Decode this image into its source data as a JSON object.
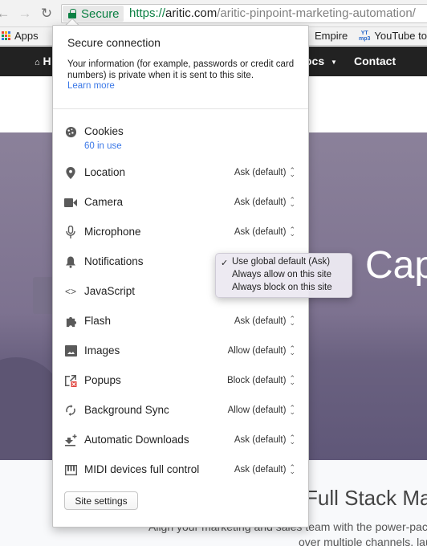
{
  "browser": {
    "back_icon": "arrow-left-icon",
    "forward_icon": "arrow-right-icon",
    "reload_icon": "reload-icon",
    "secure_label": "Secure",
    "url_scheme": "https://",
    "url_host": "aritic.com",
    "url_path": "/aritic-pinpoint-marketing-automation/",
    "bookmarks": [
      {
        "label": "Apps",
        "icon": "apps-grid-icon"
      },
      {
        "label": "Empire",
        "icon": ""
      },
      {
        "label": "YouTube to",
        "icon": "yt-mp3-icon",
        "icon_text_top": "YT",
        "icon_text_bottom": "mp3"
      }
    ]
  },
  "website": {
    "nav": {
      "home_initial": "H",
      "docs_label": "ocs",
      "contact_label": "Contact"
    },
    "hero_title": "Cap",
    "section_title": "Full Stack Ma",
    "section_text_1": "Align your marketing and sales team with the power-packed",
    "section_text_2": "over multiple channels, laun"
  },
  "popup": {
    "connection_title": "Secure connection",
    "connection_desc": "Your information (for example, passwords or credit card numbers) is private when it is sent to this site.",
    "learn_more": "Learn more",
    "cookies": {
      "label": "Cookies",
      "sub": "60 in use",
      "icon": "cookie-icon"
    },
    "permissions": [
      {
        "label": "Location",
        "value": "Ask (default)",
        "icon": "location-pin-icon"
      },
      {
        "label": "Camera",
        "value": "Ask (default)",
        "icon": "camera-icon"
      },
      {
        "label": "Microphone",
        "value": "Ask (default)",
        "icon": "microphone-icon"
      },
      {
        "label": "Notifications",
        "value": "Use global default (Ask)",
        "icon": "bell-icon"
      },
      {
        "label": "JavaScript",
        "value": "",
        "icon": "code-icon"
      },
      {
        "label": "Flash",
        "value": "Ask (default)",
        "icon": "puzzle-icon"
      },
      {
        "label": "Images",
        "value": "Allow (default)",
        "icon": "image-icon"
      },
      {
        "label": "Popups",
        "value": "Block (default)",
        "icon": "popup-blocked-icon"
      },
      {
        "label": "Background Sync",
        "value": "Allow (default)",
        "icon": "sync-icon"
      },
      {
        "label": "Automatic Downloads",
        "value": "Ask (default)",
        "icon": "download-icon"
      },
      {
        "label": "MIDI devices full control",
        "value": "Ask (default)",
        "icon": "piano-icon"
      }
    ],
    "site_settings_button": "Site settings"
  },
  "notifications_menu": {
    "options": [
      {
        "label": "Use global default (Ask)",
        "checked": true
      },
      {
        "label": "Always allow on this site",
        "checked": false
      },
      {
        "label": "Always block on this site",
        "checked": false
      }
    ],
    "check_glyph": "✓"
  }
}
